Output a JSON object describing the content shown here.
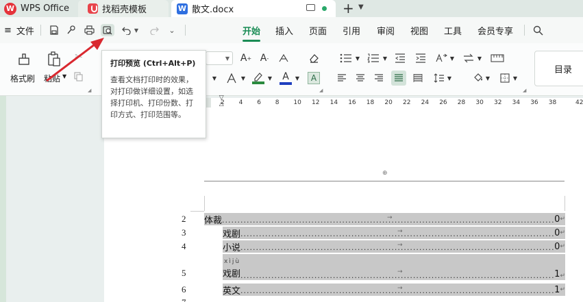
{
  "tabs": [
    {
      "label": "WPS Office",
      "icon": "wps-logo-icon"
    },
    {
      "label": "找稻壳模板",
      "icon": "docer-logo-icon"
    },
    {
      "label": "散文.docx",
      "icon": "word-doc-icon",
      "active": true
    }
  ],
  "menu": {
    "file_label": "文件",
    "items": [
      "开始",
      "插入",
      "页面",
      "引用",
      "审阅",
      "视图",
      "工具",
      "会员专享"
    ],
    "active": "开始"
  },
  "ribbon": {
    "format_painter": "格式刷",
    "paste": "粘贴",
    "toc": "目录"
  },
  "tooltip": {
    "title": "打印预览 (Ctrl+Alt+P)",
    "body": "查看文档打印时的效果，对打印做详细设置，如选择打印机、打印份数、打印方式、打印范围等。"
  },
  "ruler": {
    "ticks": [
      "2",
      "4",
      "6",
      "8",
      "10",
      "12",
      "14",
      "16",
      "18",
      "20",
      "22",
      "24",
      "26",
      "28",
      "30",
      "32",
      "34",
      "36",
      "38",
      "42"
    ]
  },
  "document": {
    "header_mark": "⊕",
    "toc_entries": [
      {
        "line": "2",
        "text": "体裁",
        "page": "0",
        "indent": 0
      },
      {
        "line": "3",
        "text": "戏剧",
        "page": "0",
        "indent": 1
      },
      {
        "line": "4",
        "text": "小说",
        "page": "0",
        "indent": 1
      },
      {
        "line": "5",
        "text": "戏剧",
        "page": "1",
        "indent": 1,
        "ruby": "xìjù"
      },
      {
        "line": "6",
        "text": "英文",
        "page": "1",
        "indent": 1
      }
    ],
    "next_line": "7"
  },
  "colors": {
    "accent": "#1a8c55",
    "arrow": "#d9282f",
    "toc_highlight": "#c8c8c8"
  }
}
